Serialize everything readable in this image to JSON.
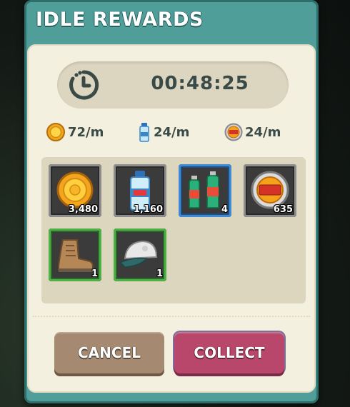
{
  "header": {
    "title": "IDLE REWARDS"
  },
  "timer": {
    "icon": "stopwatch-icon",
    "value": "00:48:25"
  },
  "rates": [
    {
      "icon": "gold-coin-icon",
      "label": "72/m"
    },
    {
      "icon": "exp-bottle-icon",
      "label": "24/m"
    },
    {
      "icon": "exp-coin-icon",
      "label": "24/m"
    }
  ],
  "rewards": [
    {
      "icon": "gold-coin-icon",
      "qty": "3,480",
      "rarity": "gray"
    },
    {
      "icon": "exp-bottle-icon",
      "qty": "1,160",
      "rarity": "gray"
    },
    {
      "icon": "energy-drinks-icon",
      "qty": "4",
      "rarity": "blue"
    },
    {
      "icon": "exp-coin-icon",
      "qty": "635",
      "rarity": "gray"
    },
    {
      "icon": "boot-icon",
      "qty": "1",
      "rarity": "green"
    },
    {
      "icon": "cap-icon",
      "qty": "1",
      "rarity": "green"
    }
  ],
  "buttons": {
    "cancel": "CANCEL",
    "collect": "COLLECT"
  },
  "colors": {
    "frame": "#4f9e9a",
    "panel": "#f4f0df",
    "cancel": "#a58a71",
    "collect": "#b9466b",
    "rare_blue": "#3d8ad9",
    "uncommon_green": "#4db146"
  }
}
